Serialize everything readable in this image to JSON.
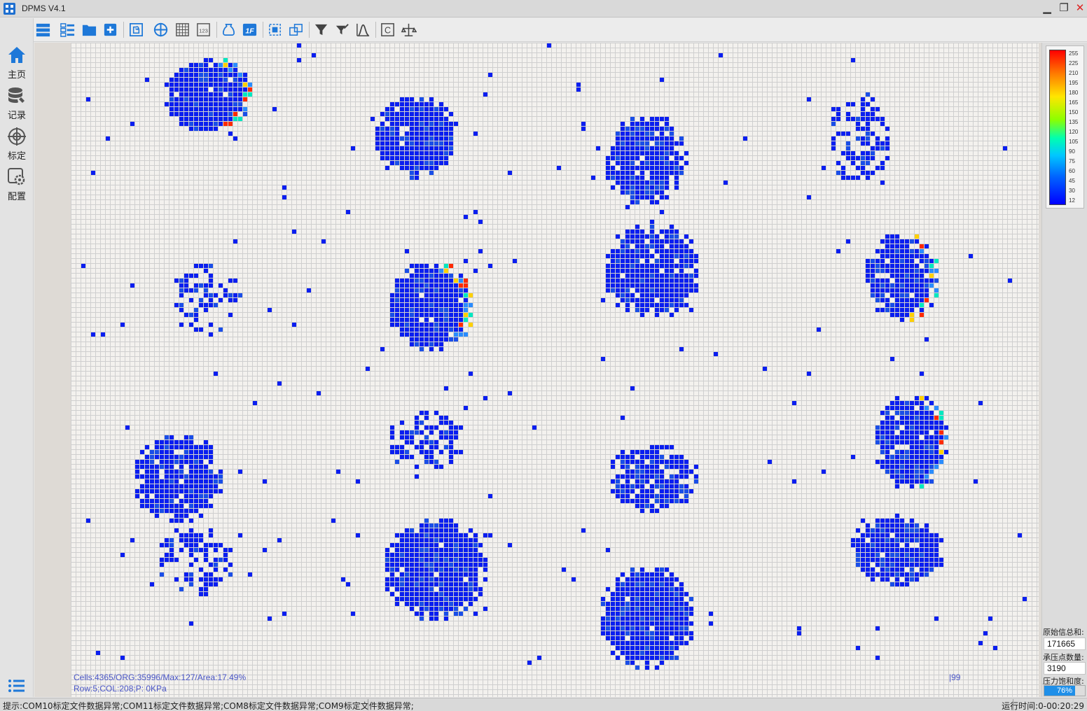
{
  "window": {
    "title": "DPMS V4.1",
    "controls": [
      "minimize",
      "maximize",
      "close"
    ]
  },
  "toolbar": {
    "buttons": [
      {
        "name": "list-view-icon"
      },
      {
        "name": "detail-view-icon"
      },
      {
        "name": "open-folder-icon"
      },
      {
        "name": "add-icon"
      },
      {
        "name": "puzzle-icon"
      },
      {
        "name": "crosshair-icon"
      },
      {
        "name": "grid-icon"
      },
      {
        "name": "number-display-icon"
      },
      {
        "name": "bag-icon"
      },
      {
        "name": "frame-1f-icon"
      },
      {
        "name": "select-region-icon"
      },
      {
        "name": "overlap-region-icon"
      },
      {
        "name": "filter-icon"
      },
      {
        "name": "filter-settings-icon"
      },
      {
        "name": "curve-chart-icon"
      },
      {
        "name": "calibrate-c-icon"
      },
      {
        "name": "balance-icon"
      }
    ]
  },
  "sidebar": {
    "items": [
      {
        "label": "主页",
        "icon": "home-icon"
      },
      {
        "label": "记录",
        "icon": "database-icon"
      },
      {
        "label": "标定",
        "icon": "crosshair-icon"
      },
      {
        "label": "配置",
        "icon": "gear-icon"
      }
    ],
    "menu_icon": "list-menu-icon"
  },
  "canvas": {
    "info_line1": "Cells:4365/ORG:35996/Max:127/Area:17.49%",
    "info_line2": "Row:5;COL:208;P: 0KPa",
    "frame_number": "|99"
  },
  "colorbar": {
    "ticks": [
      "255",
      "225",
      "210",
      "195",
      "180",
      "165",
      "150",
      "135",
      "120",
      "105",
      "90",
      "75",
      "60",
      "45",
      "30",
      "12"
    ],
    "colors": {
      "max": "#ff0000",
      "mid": "#00ffb0",
      "min": "#0000ff"
    }
  },
  "stats": {
    "raw_sum_label": "原始信总和:",
    "raw_sum_value": "171665",
    "points_label": "承压点数量:",
    "points_value": "3190",
    "saturation_label": "压力饱和度:",
    "saturation_value": "76%",
    "saturation_fraction": 0.76
  },
  "statusbar": {
    "message": "提示:COM10标定文件数据异常;COM11标定文件数据异常;COM8标定文件数据异常;COM9标定文件数据异常;",
    "run_time": "运行时间:0-00:20:29"
  }
}
